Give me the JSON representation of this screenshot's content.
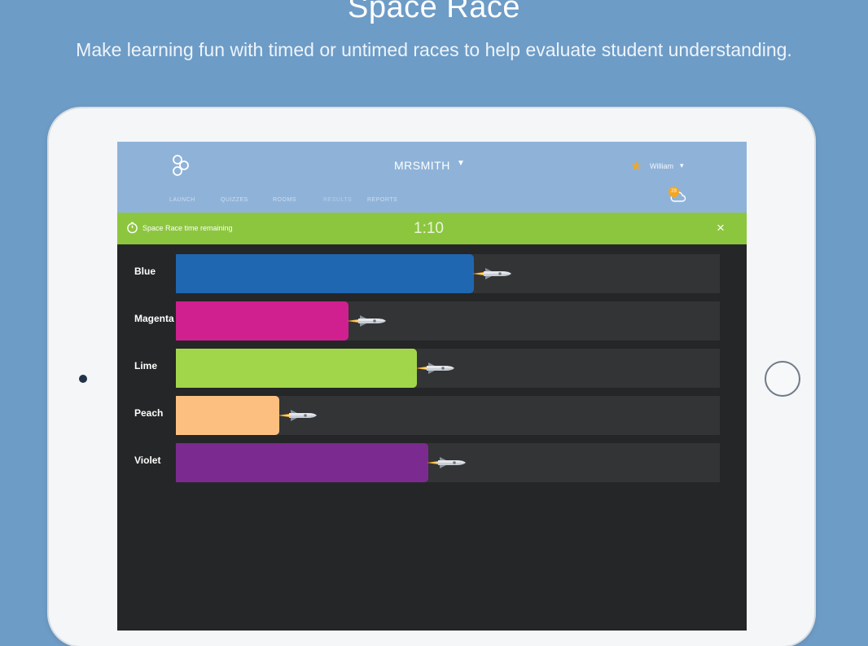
{
  "hero": {
    "title": "Space Race",
    "subtitle": "Make learning fun with timed or untimed races to help evaluate student understanding."
  },
  "header": {
    "room": "MRSMITH",
    "user": "William",
    "badge": "29",
    "tabs": [
      "LAUNCH",
      "QUIZZES",
      "ROOMS",
      "RESULTS",
      "REPORTS"
    ],
    "active_tab": "RESULTS"
  },
  "timer": {
    "label": "Space Race time remaining",
    "value": "1:10",
    "close": "×"
  },
  "colors": {
    "Blue": "#1f67b1",
    "Magenta": "#d0208f",
    "Lime": "#a2d64a",
    "Peach": "#fdbf80",
    "Violet": "#7b2b8f"
  },
  "race": {
    "teams": [
      {
        "name": "Blue",
        "progress": 0.548,
        "color": "#1f67b1"
      },
      {
        "name": "Magenta",
        "progress": 0.317,
        "color": "#d0208f"
      },
      {
        "name": "Lime",
        "progress": 0.443,
        "color": "#a2d64a"
      },
      {
        "name": "Peach",
        "progress": 0.19,
        "color": "#fdbf80"
      },
      {
        "name": "Violet",
        "progress": 0.464,
        "color": "#7b2b8f"
      }
    ]
  }
}
